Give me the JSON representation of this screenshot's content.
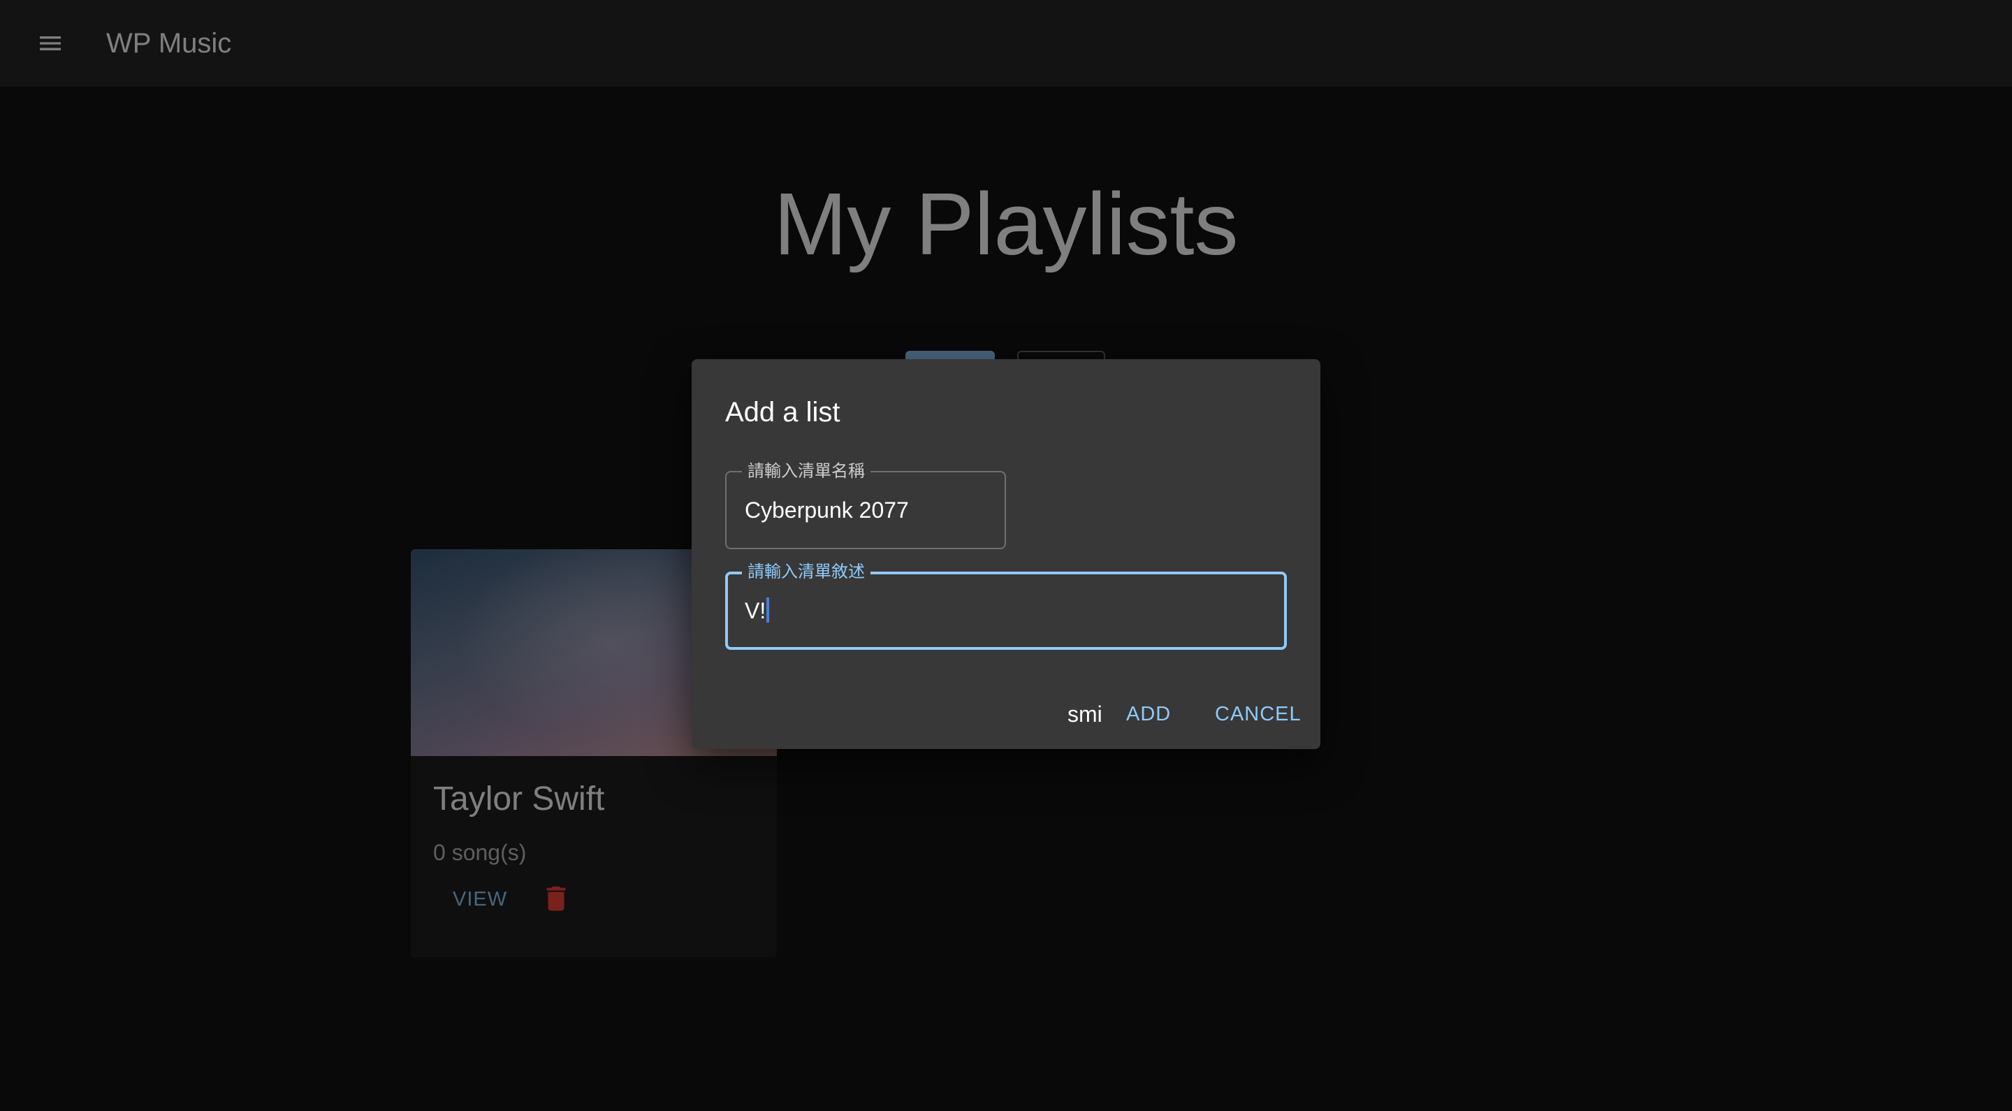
{
  "appbar": {
    "title": "WP Music",
    "menu_icon": "menu-icon"
  },
  "main": {
    "title": "My Playlists"
  },
  "playlist_card": {
    "title": "Taylor Swift",
    "subtitle": "0 song(s)",
    "view_label": "VIEW",
    "delete_icon": "trash-icon"
  },
  "dialog": {
    "title": "Add a list",
    "name_field": {
      "label": "請輸入清單名稱",
      "value": "Cyberpunk 2077"
    },
    "description_field": {
      "label": "請輸入清單敘述",
      "value": "V!"
    },
    "extra_text": "smi",
    "add_label": "ADD",
    "cancel_label": "CANCEL"
  },
  "colors": {
    "primary": "#90caf9",
    "delete": "#f44336",
    "appbar_bg": "#272727",
    "page_bg": "#121212",
    "dialog_bg": "#383838"
  }
}
